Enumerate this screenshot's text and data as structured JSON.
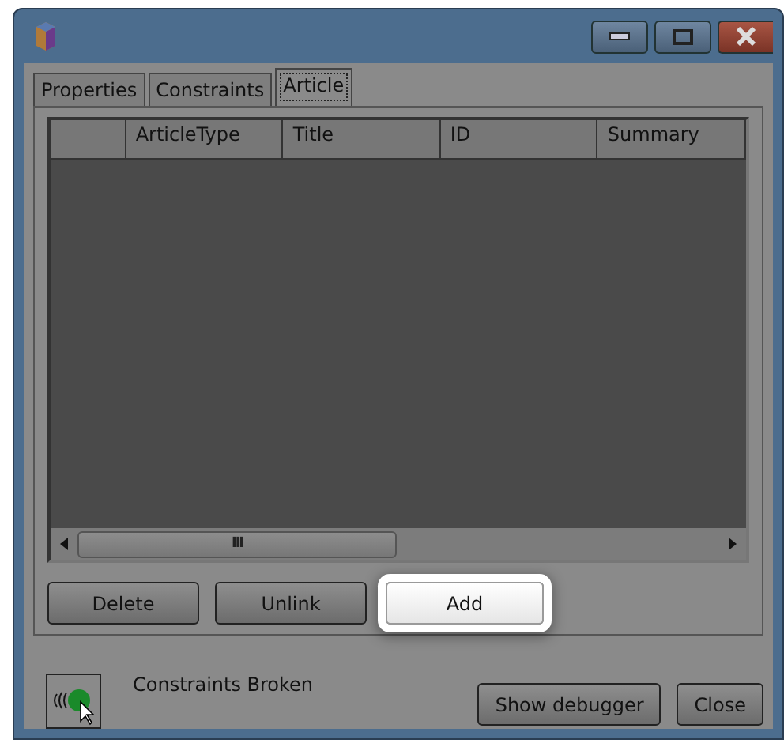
{
  "tabs": [
    {
      "label": "Properties",
      "selected": false
    },
    {
      "label": "Constraints",
      "selected": false
    },
    {
      "label": "Article",
      "selected": true
    }
  ],
  "table": {
    "columns": [
      "ArticleType",
      "Title",
      "ID",
      "Summary"
    ],
    "scrollbar_grip": "III"
  },
  "actions": [
    {
      "label": "Delete",
      "highlighted": false
    },
    {
      "label": "Unlink",
      "highlighted": false
    },
    {
      "label": "Add",
      "highlighted": true
    }
  ],
  "status": "Constraints Broken",
  "footer_buttons": [
    {
      "label": "Show debugger"
    },
    {
      "label": "Close"
    }
  ]
}
